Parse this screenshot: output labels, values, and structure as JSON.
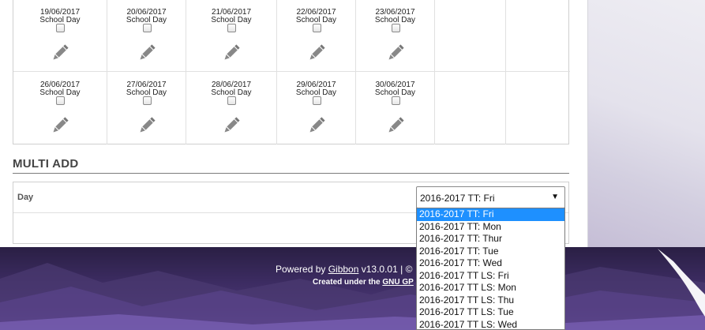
{
  "calendar": {
    "days": [
      {
        "date": "19/06/2017",
        "type": "School Day"
      },
      {
        "date": "20/06/2017",
        "type": "School Day"
      },
      {
        "date": "21/06/2017",
        "type": "School Day"
      },
      {
        "date": "22/06/2017",
        "type": "School Day"
      },
      {
        "date": "23/06/2017",
        "type": "School Day"
      },
      {
        "date": "26/06/2017",
        "type": "School Day"
      },
      {
        "date": "27/06/2017",
        "type": "School Day"
      },
      {
        "date": "28/06/2017",
        "type": "School Day"
      },
      {
        "date": "29/06/2017",
        "type": "School Day"
      },
      {
        "date": "30/06/2017",
        "type": "School Day"
      }
    ],
    "edit_icon": "pencil-icon",
    "checkbox_checked": false
  },
  "multi_add": {
    "title": "MULTI ADD",
    "day_label": "Day",
    "select_value": "2016-2017 TT: Fri",
    "options": [
      "2016-2017 TT: Fri",
      "2016-2017 TT: Mon",
      "2016-2017 TT: Thur",
      "2016-2017 TT: Tue",
      "2016-2017 TT: Wed",
      "2016-2017 TT LS: Fri",
      "2016-2017 TT LS: Mon",
      "2016-2017 TT LS: Thu",
      "2016-2017 TT LS: Tue",
      "2016-2017 TT LS: Wed"
    ],
    "selected_index": 0
  },
  "footer": {
    "powered_prefix": "Powered by ",
    "powered_link": "Gibbon",
    "powered_suffix": " v13.0.01 | ©",
    "created_prefix": "Created under the ",
    "created_link": "GNU GP"
  },
  "colors": {
    "selected_option_bg": "#1e90ff",
    "footer_bg": "#3b2b60"
  }
}
